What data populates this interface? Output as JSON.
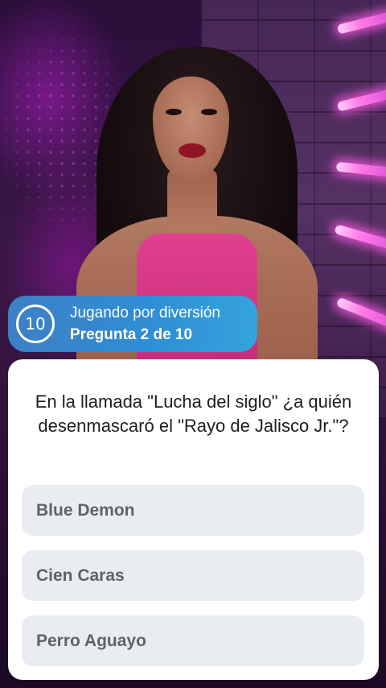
{
  "status": {
    "timer_value": "10",
    "mode_label": "Jugando por diversión",
    "progress_label": "Pregunta 2 de 10"
  },
  "quiz": {
    "question": "En la llamada \"Lucha del siglo\" ¿a quién desenmascaró el \"Rayo de Jalisco Jr.\"?",
    "answers": [
      "Blue Demon",
      "Cien Caras",
      "Perro Aguayo"
    ]
  },
  "colors": {
    "pill_gradient_start": "#3e7fc5",
    "pill_gradient_end": "#35a3dc",
    "card_background": "#ffffff",
    "answer_background": "#e9ecf0",
    "answer_text": "#5f6368",
    "question_text": "#1e1e1e"
  },
  "icons": {
    "timer": "countdown-circle-icon"
  }
}
